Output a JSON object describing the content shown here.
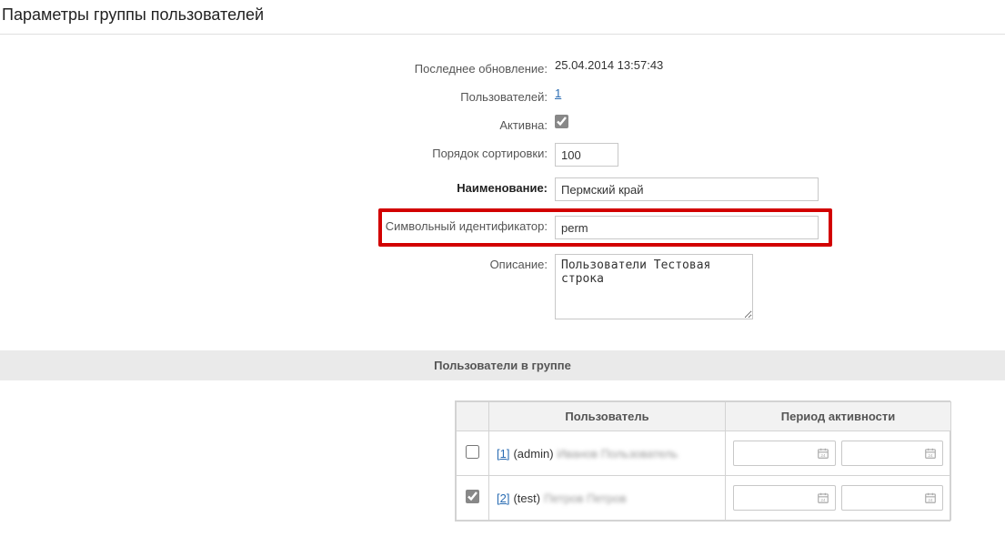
{
  "title": "Параметры группы пользователей",
  "form": {
    "last_update_label": "Последнее обновление:",
    "last_update_value": "25.04.2014 13:57:43",
    "users_count_label": "Пользователей:",
    "users_count_value": "1",
    "active_label": "Активна:",
    "active_checked": true,
    "sort_label": "Порядок сортировки:",
    "sort_value": "100",
    "name_label": "Наименование:",
    "name_value": "Пермский край",
    "sym_id_label": "Символьный идентификатор:",
    "sym_id_value": "perm",
    "desc_label": "Описание:",
    "desc_value_prefix": "Пользователи ",
    "desc_value_blur": "Тестовая строка"
  },
  "section_header": "Пользователи в группе",
  "table": {
    "col_user": "Пользователь",
    "col_period": "Период активности",
    "rows": [
      {
        "checked": false,
        "id_link": "[1]",
        "login": "(admin)",
        "name_blur": "Иванов Пользователь"
      },
      {
        "checked": true,
        "id_link": "[2]",
        "login": "(test)",
        "name_blur": "Петров Петров"
      }
    ]
  }
}
